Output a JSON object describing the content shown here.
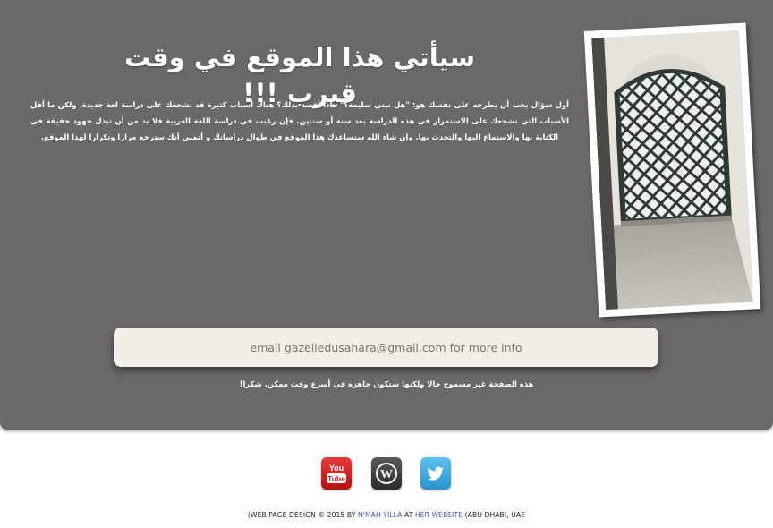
{
  "hero": {
    "title": "سيأتي هذا الموقع في وقت قيرب !!!",
    "intro": "أول سؤال يجب أن يطرحه على نفسك هو: \"هل نيتي سليمة؟\" ماذا أقصد بذلك؟ هناك أسباب كثيرة قد تشجعك على دراسة لغة جديدة. ولكن ما أقل الأسباب التي تشجعك على الاستمرار في هذه الدراسة بعد سنة أو سنتين. فإن رغبت في دراسة اللغة العربية فلا بد من أن تبذل جهود حقيقة في الكتابة بها والاستماع اليها والتحدث بها. وإن شاء الله ستساعدك هذا الموقع في طوال دراساتك و أتمنى أنك سترجع مرارا وتكرارا لهذا الموقع."
  },
  "email_box": {
    "text": "email gazelledusahara@gmail.com for more info"
  },
  "notice": {
    "text": "هذه الصفحة غير مسموح حالا ولكنها ستكون جاهزة في أسرع وقت ممكن. شكرا!"
  },
  "social": {
    "youtube_label": "You",
    "youtube_label2": "Tube",
    "wordpress_label": "W"
  },
  "footer": {
    "prefix": "(WEB PAGE DESIGN © 2015 BY ",
    "author": "N'MAH YILLA",
    "middle": " AT ",
    "site": "HER WEBSITE",
    "suffix": " (ABU DHABI, UAE"
  },
  "colors": {
    "panel": "#6b686b",
    "email_box": "#f1efe8",
    "link": "#3a57c9"
  }
}
